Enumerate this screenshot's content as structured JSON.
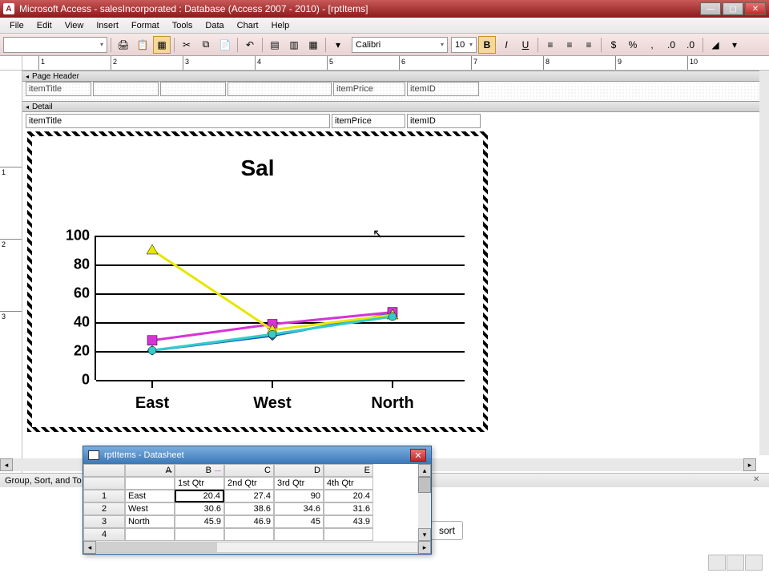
{
  "window": {
    "title": "Microsoft Access - salesIncorporated : Database (Access 2007 - 2010) - [rptItems]",
    "app_letter": "A"
  },
  "menu": {
    "file": "File",
    "edit": "Edit",
    "view": "View",
    "insert": "Insert",
    "format": "Format",
    "tools": "Tools",
    "data": "Data",
    "chart": "Chart",
    "help": "Help"
  },
  "toolbar": {
    "font_name": "Calibri",
    "font_size": "10"
  },
  "sections": {
    "page_header": "Page Header",
    "detail": "Detail"
  },
  "fields": {
    "itemTitle": "itemTitle",
    "itemPrice": "itemPrice",
    "itemID": "itemID"
  },
  "chart_data": {
    "type": "line",
    "title": "Sal",
    "categories": [
      "East",
      "West",
      "North"
    ],
    "series": [
      {
        "name": "1st Qtr",
        "values": [
          20.4,
          30.6,
          45.9
        ],
        "color": "#1f5fbf",
        "marker": "diamond"
      },
      {
        "name": "2nd Qtr",
        "values": [
          27.4,
          38.6,
          46.9
        ],
        "color": "#d633d6",
        "marker": "square"
      },
      {
        "name": "3rd Qtr",
        "values": [
          90,
          34.6,
          45
        ],
        "color": "#e6e600",
        "marker": "triangle"
      },
      {
        "name": "4th Qtr",
        "values": [
          20.4,
          31.6,
          43.9
        ],
        "color": "#33cccc",
        "marker": "circle"
      }
    ],
    "ylim": [
      0,
      100
    ],
    "yticks": [
      0,
      20,
      40,
      60,
      80,
      100
    ],
    "xlabel": "",
    "ylabel": ""
  },
  "datasheet": {
    "title": "rptItems - Datasheet",
    "col_letters": [
      "A",
      "B",
      "C",
      "D",
      "E"
    ],
    "col_headers": [
      "",
      "1st Qtr",
      "2nd Qtr",
      "3rd Qtr",
      "4th Qtr"
    ],
    "rows": [
      {
        "n": "1",
        "label": "East",
        "v": [
          "20.4",
          "27.4",
          "90",
          "20.4"
        ]
      },
      {
        "n": "2",
        "label": "West",
        "v": [
          "30.6",
          "38.6",
          "34.6",
          "31.6"
        ]
      },
      {
        "n": "3",
        "label": "North",
        "v": [
          "45.9",
          "46.9",
          "45",
          "43.9"
        ]
      },
      {
        "n": "4",
        "label": "",
        "v": [
          "",
          "",
          "",
          ""
        ]
      }
    ]
  },
  "bottom_bar": {
    "label": "Group, Sort, and To"
  },
  "sort_button": {
    "label": "sort"
  },
  "ruler_h": [
    "1",
    "2",
    "3",
    "4",
    "5",
    "6",
    "7",
    "8",
    "9",
    "10"
  ],
  "ruler_v": [
    "1",
    "2",
    "3"
  ]
}
